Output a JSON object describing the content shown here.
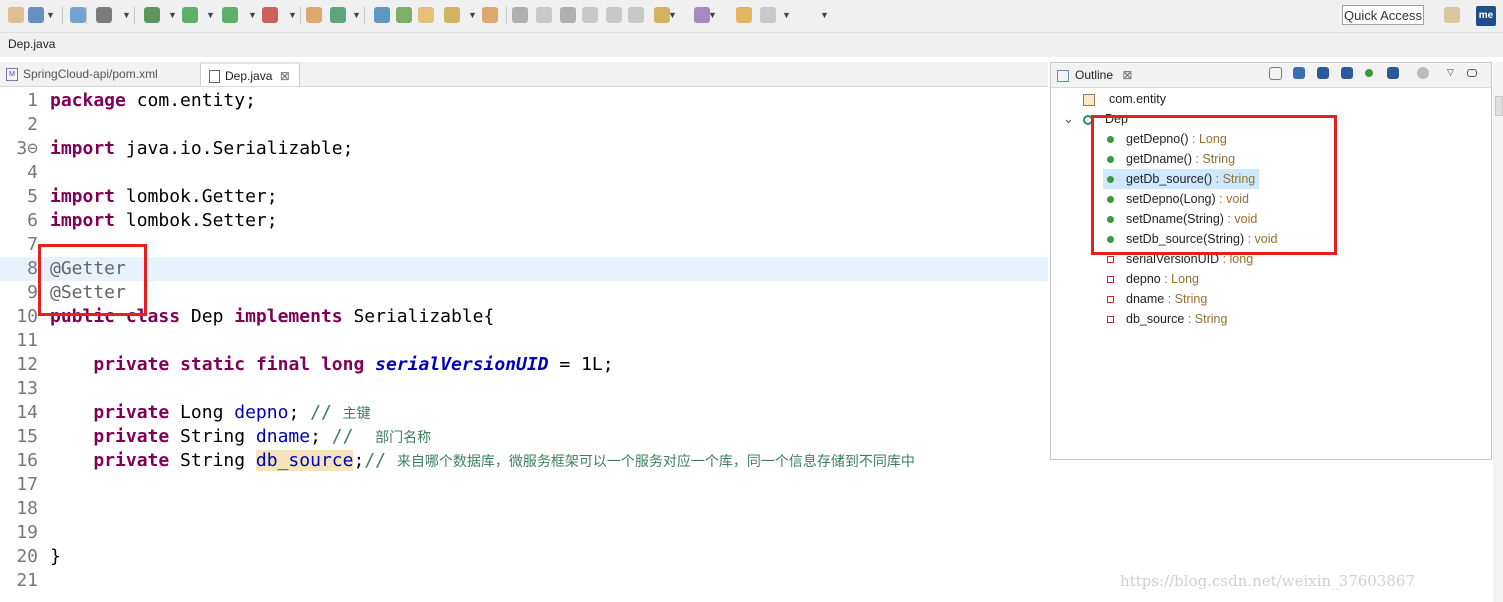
{
  "toolbar": {
    "quick_access": "Quick Access",
    "me_label": "me",
    "icons": [
      "new-file-icon",
      "search-icon",
      "globe-icon",
      "terminal-icon",
      "debug-icon",
      "run-icon",
      "run-config-icon",
      "stop-icon",
      "build-icon",
      "refresh-icon",
      "open-type-icon",
      "open-folder-icon",
      "folder-icon",
      "pin-icon",
      "package-icon",
      "marker-icon",
      "pencil-icon",
      "link-icon",
      "copy-icon",
      "doc-icon",
      "paragraph-icon",
      "down-icon",
      "up-icon",
      "back-icon",
      "forward-icon"
    ]
  },
  "window_title": "Dep.java",
  "editor_tabs": [
    {
      "label": "SpringCloud-api/pom.xml",
      "icon": "maven-icon"
    },
    {
      "label": "Dep.java",
      "icon": "java-file-icon",
      "close": "⊠"
    }
  ],
  "code_lines": [
    {
      "num": "1",
      "parts": [
        {
          "t": "package",
          "c": "kw"
        },
        {
          "t": " com.entity;",
          "c": ""
        }
      ]
    },
    {
      "num": "2",
      "parts": []
    },
    {
      "num": "3⊖",
      "parts": [
        {
          "t": "import",
          "c": "kw"
        },
        {
          "t": " java.io.Serializable;",
          "c": ""
        }
      ]
    },
    {
      "num": "4",
      "parts": []
    },
    {
      "num": "5",
      "parts": [
        {
          "t": "import",
          "c": "kw"
        },
        {
          "t": " lombok.Getter;",
          "c": ""
        }
      ]
    },
    {
      "num": "6",
      "parts": [
        {
          "t": "import",
          "c": "kw"
        },
        {
          "t": " lombok.Setter;",
          "c": ""
        }
      ]
    },
    {
      "num": "7",
      "parts": []
    },
    {
      "num": "8",
      "parts": [
        {
          "t": "@Getter",
          "c": "ann"
        }
      ]
    },
    {
      "num": "9",
      "parts": [
        {
          "t": "@Setter",
          "c": "ann"
        }
      ]
    },
    {
      "num": "10",
      "parts": [
        {
          "t": "public",
          "c": "kw"
        },
        {
          "t": " ",
          "c": ""
        },
        {
          "t": "class",
          "c": "kw"
        },
        {
          "t": " Dep ",
          "c": ""
        },
        {
          "t": "implements",
          "c": "kw"
        },
        {
          "t": " Serializable{",
          "c": ""
        }
      ]
    },
    {
      "num": "11",
      "parts": []
    },
    {
      "num": "12",
      "parts": [
        {
          "t": "    ",
          "c": ""
        },
        {
          "t": "private",
          "c": "kw"
        },
        {
          "t": " ",
          "c": ""
        },
        {
          "t": "static",
          "c": "kw"
        },
        {
          "t": " ",
          "c": ""
        },
        {
          "t": "final",
          "c": "kw"
        },
        {
          "t": " ",
          "c": ""
        },
        {
          "t": "long",
          "c": "kw"
        },
        {
          "t": " ",
          "c": ""
        },
        {
          "t": "serialVersionUID",
          "c": "sfld"
        },
        {
          "t": " = 1L;",
          "c": ""
        }
      ]
    },
    {
      "num": "13",
      "parts": []
    },
    {
      "num": "14",
      "parts": [
        {
          "t": "    ",
          "c": ""
        },
        {
          "t": "private",
          "c": "kw"
        },
        {
          "t": " Long ",
          "c": ""
        },
        {
          "t": "depno",
          "c": "fld"
        },
        {
          "t": "; ",
          "c": ""
        },
        {
          "t": "// ",
          "c": "cmt"
        },
        {
          "t": "主键",
          "c": "cmt cjk"
        }
      ]
    },
    {
      "num": "15",
      "parts": [
        {
          "t": "    ",
          "c": ""
        },
        {
          "t": "private",
          "c": "kw"
        },
        {
          "t": " String ",
          "c": ""
        },
        {
          "t": "dname",
          "c": "fld"
        },
        {
          "t": "; ",
          "c": ""
        },
        {
          "t": "//  ",
          "c": "cmt"
        },
        {
          "t": "部门名称",
          "c": "cmt cjk"
        }
      ]
    },
    {
      "num": "16",
      "parts": [
        {
          "t": "    ",
          "c": ""
        },
        {
          "t": "private",
          "c": "kw"
        },
        {
          "t": " String ",
          "c": ""
        },
        {
          "t": "db_source",
          "c": "fld hl"
        },
        {
          "t": ";",
          "c": ""
        },
        {
          "t": "// ",
          "c": "cmt"
        },
        {
          "t": "来自哪个数据库，微服务框架可以一个服务对应一个库，同一个信息存储到不同库中",
          "c": "cmt cjk"
        }
      ]
    },
    {
      "num": "17",
      "parts": []
    },
    {
      "num": "18",
      "parts": []
    },
    {
      "num": "19",
      "parts": []
    },
    {
      "num": "20",
      "parts": [
        {
          "t": "}",
          "c": ""
        }
      ]
    },
    {
      "num": "21",
      "parts": []
    }
  ],
  "outline": {
    "tab_label": "Outline",
    "close": "⊠",
    "items": [
      {
        "label": "com.entity",
        "type": "",
        "icon": "package-icon",
        "indent": 0
      },
      {
        "label": "Dep",
        "type": "",
        "icon": "class-icon",
        "indent": 0,
        "expanded": "⌄"
      },
      {
        "label": "getDepno()",
        "type": " : Long",
        "icon": "public-method-icon",
        "indent": 1
      },
      {
        "label": "getDname()",
        "type": " : String",
        "icon": "public-method-icon",
        "indent": 1
      },
      {
        "label": "getDb_source()",
        "type": " : String",
        "icon": "public-method-icon",
        "indent": 1,
        "selected": true
      },
      {
        "label": "setDepno(Long)",
        "type": " : void",
        "icon": "public-method-icon",
        "indent": 1
      },
      {
        "label": "setDname(String)",
        "type": " : void",
        "icon": "public-method-icon",
        "indent": 1
      },
      {
        "label": "setDb_source(String)",
        "type": " : void",
        "icon": "public-method-icon",
        "indent": 1
      },
      {
        "label": "serialVersionUID",
        "type": " : long",
        "icon": "static-field-icon",
        "indent": 1
      },
      {
        "label": "depno",
        "type": " : Long",
        "icon": "private-field-icon",
        "indent": 1
      },
      {
        "label": "dname",
        "type": " : String",
        "icon": "private-field-icon",
        "indent": 1
      },
      {
        "label": "db_source",
        "type": " : String",
        "icon": "private-field-icon",
        "indent": 1
      }
    ]
  },
  "watermark": "https://blog.csdn.net/weixin_37603867",
  "colors": {
    "keyword": "#7f0055",
    "annotation": "#646464",
    "field": "#0000c0",
    "comment": "#3f7f5f",
    "highlight_box": "#e8201c"
  }
}
